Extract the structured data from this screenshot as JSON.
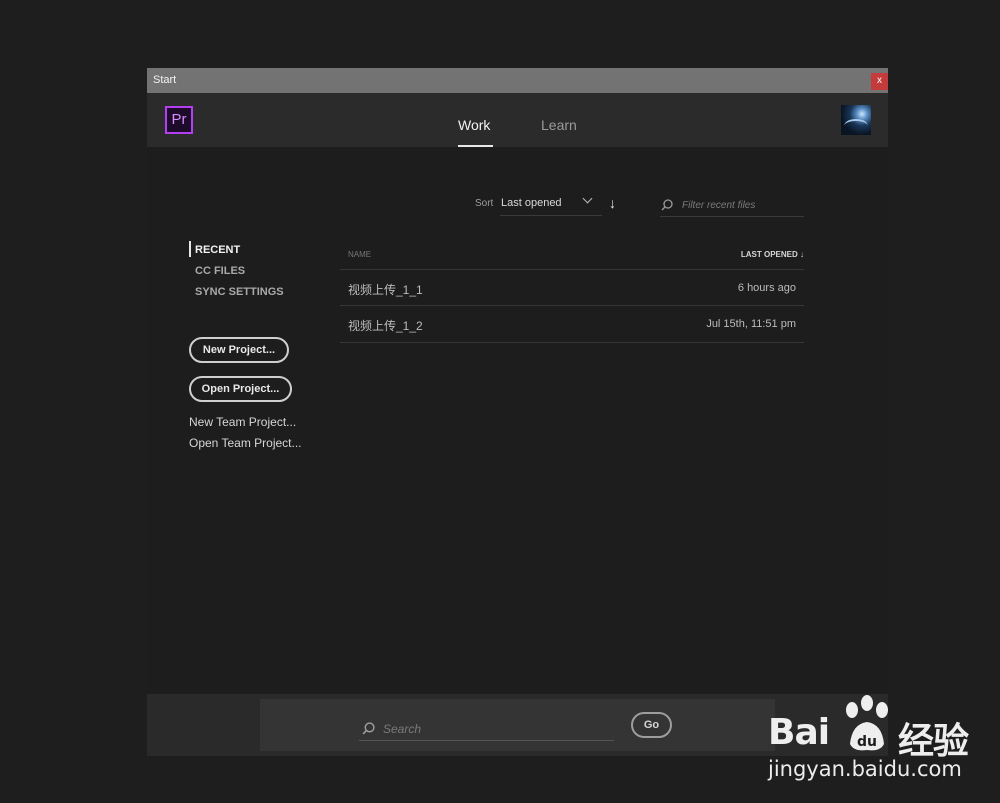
{
  "window": {
    "title": "Start",
    "close_label": "x"
  },
  "header": {
    "app_logo": "Pr",
    "tabs": [
      {
        "label": "Work",
        "active": true
      },
      {
        "label": "Learn",
        "active": false
      }
    ]
  },
  "sort": {
    "label": "Sort",
    "value": "Last opened",
    "direction_icon": "↓"
  },
  "filter": {
    "placeholder": "Filter recent files"
  },
  "sidebar": {
    "nav": [
      {
        "label": "RECENT",
        "active": true
      },
      {
        "label": "CC FILES",
        "active": false
      },
      {
        "label": "SYNC SETTINGS",
        "active": false
      }
    ],
    "new_project_label": "New Project...",
    "open_project_label": "Open Project...",
    "new_team_project_label": "New Team Project...",
    "open_team_project_label": "Open Team Project..."
  },
  "table": {
    "columns": [
      "NAME",
      "LAST OPENED ↓"
    ],
    "rows": [
      {
        "name": "视频上传_1_1",
        "last_opened": "6 hours ago"
      },
      {
        "name": "视频上传_1_2",
        "last_opened": "Jul 15th, 11:51 pm"
      }
    ]
  },
  "footer": {
    "search_placeholder": "Search",
    "go_label": "Go"
  },
  "watermark": {
    "brand": "Bai",
    "brand_suffix": "经验",
    "url": "jingyan.baidu.com"
  },
  "colors": {
    "accent_premiere": "#b53ef5",
    "close_red": "#c43b3b",
    "background": "#1d1d1d"
  }
}
